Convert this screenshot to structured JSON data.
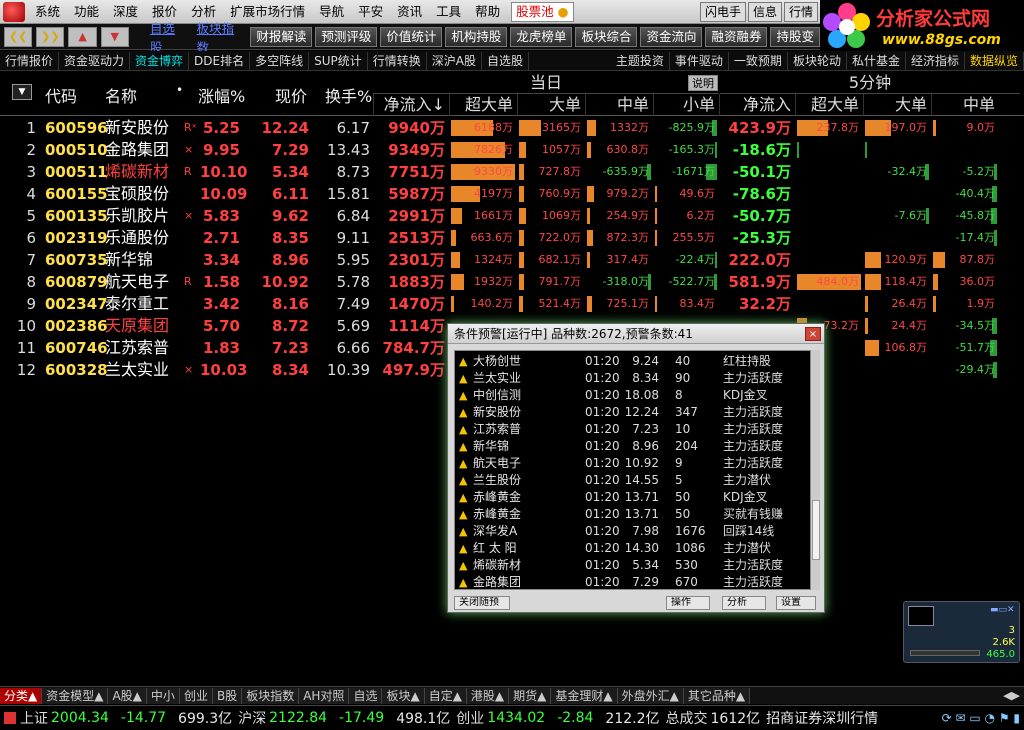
{
  "menubar": {
    "items": [
      "系统",
      "功能",
      "深度",
      "报价",
      "分析",
      "扩展市场行情",
      "导航",
      "平安",
      "资讯",
      "工具",
      "帮助"
    ],
    "stock_pool": "股票池",
    "right_buttons": [
      "闪电手",
      "信息",
      "行情"
    ]
  },
  "brand": {
    "title": "分析家公式网",
    "url": "www.88gs.com"
  },
  "toolbar": {
    "links": [
      "自选股",
      "板块指数"
    ],
    "buttons": [
      "财报解读",
      "预测评级",
      "价值统计",
      "机构持股",
      "龙虎榜单",
      "板块综合",
      "资金流向",
      "融资融券",
      "持股变"
    ]
  },
  "tabs2": {
    "left": [
      "行情报价",
      "资金驱动力",
      "资金博弈",
      "DDE排名",
      "多空阵线",
      "SUP统计",
      "行情转换",
      "深沪A股",
      "自选股"
    ],
    "right": [
      "主题投资",
      "事件驱动",
      "一致预期",
      "板块轮动",
      "私什基金",
      "经济指标",
      "数据纵览"
    ]
  },
  "header": {
    "code": "代码",
    "name": "名称",
    "dot": "•",
    "change": "涨幅%",
    "price": "现价",
    "turnover": "换手%",
    "group_today": "当日",
    "explain": "说明",
    "group_5min": "5分钟",
    "today_cols": [
      "净流入↓",
      "超大单",
      "大单",
      "中单",
      "小单"
    ],
    "min5_cols": [
      "净流入",
      "超大单",
      "大单",
      "中单"
    ]
  },
  "rows": [
    {
      "idx": "1",
      "code": "600596",
      "name": "新安股份",
      "red": false,
      "flag": "Rˣ",
      "chg": "5.25",
      "price": "12.24",
      "turn": "6.17",
      "net": "9940万",
      "today": [
        {
          "v": 6188,
          "t": "6188万"
        },
        {
          "v": 3165,
          "t": "3165万"
        },
        {
          "v": 1332,
          "t": "1332万"
        },
        {
          "v": -825.9,
          "t": "-825.9万"
        }
      ],
      "m5net": "423.9万",
      "m5": [
        {
          "v": 237.8,
          "t": "237.8万"
        },
        {
          "v": 197.0,
          "t": "197.0万"
        },
        {
          "v": 9.0,
          "t": "9.0万"
        }
      ]
    },
    {
      "idx": "2",
      "code": "000510",
      "name": "金路集团",
      "red": false,
      "flag": "×",
      "chg": "9.95",
      "price": "7.29",
      "turn": "13.43",
      "net": "9349万",
      "today": [
        {
          "v": 7826,
          "t": "7826万"
        },
        {
          "v": 1057,
          "t": "1057万"
        },
        {
          "v": 630.8,
          "t": "630.8万"
        },
        {
          "v": -165.3,
          "t": "-165.3万"
        }
      ],
      "m5net": "-18.6万",
      "m5": [
        {
          "v": -1,
          "t": ""
        },
        {
          "v": -1,
          "t": ""
        },
        {
          "v": 0,
          "t": ""
        }
      ]
    },
    {
      "idx": "3",
      "code": "000511",
      "name": "烯碳新材",
      "red": true,
      "flag": "R",
      "chg": "10.10",
      "price": "5.34",
      "turn": "8.73",
      "net": "7751万",
      "today": [
        {
          "v": 9330,
          "t": "9330万"
        },
        {
          "v": 727.8,
          "t": "727.8万"
        },
        {
          "v": -635.9,
          "t": "-635.9万"
        },
        {
          "v": -1671,
          "t": "-1671万"
        }
      ],
      "m5net": "-50.1万",
      "m5": [
        {
          "v": 0,
          "t": ""
        },
        {
          "v": -32.4,
          "t": "-32.4万"
        },
        {
          "v": -5.2,
          "t": "-5.2万"
        }
      ]
    },
    {
      "idx": "4",
      "code": "600155",
      "name": "宝硕股份",
      "red": false,
      "flag": "",
      "chg": "10.09",
      "price": "6.11",
      "turn": "15.81",
      "net": "5987万",
      "today": [
        {
          "v": 4197,
          "t": "4197万"
        },
        {
          "v": 760.9,
          "t": "760.9万"
        },
        {
          "v": 979.2,
          "t": "979.2万"
        },
        {
          "v": 49.6,
          "t": "49.6万"
        }
      ],
      "m5net": "-78.6万",
      "m5": [
        {
          "v": 0,
          "t": ""
        },
        {
          "v": 0,
          "t": ""
        },
        {
          "v": -40.4,
          "t": "-40.4万"
        }
      ]
    },
    {
      "idx": "5",
      "code": "600135",
      "name": "乐凯胶片",
      "red": false,
      "flag": "×",
      "chg": "5.83",
      "price": "9.62",
      "turn": "6.84",
      "net": "2991万",
      "today": [
        {
          "v": 1661,
          "t": "1661万"
        },
        {
          "v": 1069,
          "t": "1069万"
        },
        {
          "v": 254.9,
          "t": "254.9万"
        },
        {
          "v": 6.2,
          "t": "6.2万"
        }
      ],
      "m5net": "-50.7万",
      "m5": [
        {
          "v": 0,
          "t": ""
        },
        {
          "v": -7.6,
          "t": "-7.6万"
        },
        {
          "v": -45.8,
          "t": "-45.8万"
        }
      ]
    },
    {
      "idx": "6",
      "code": "002319",
      "name": "乐通股份",
      "red": false,
      "flag": "",
      "chg": "2.71",
      "price": "8.35",
      "turn": "9.11",
      "net": "2513万",
      "today": [
        {
          "v": 663.6,
          "t": "663.6万"
        },
        {
          "v": 722.0,
          "t": "722.0万"
        },
        {
          "v": 872.3,
          "t": "872.3万"
        },
        {
          "v": 255.5,
          "t": "255.5万"
        }
      ],
      "m5net": "-25.3万",
      "m5": [
        {
          "v": 0,
          "t": ""
        },
        {
          "v": 0,
          "t": ""
        },
        {
          "v": -17.4,
          "t": "-17.4万"
        }
      ]
    },
    {
      "idx": "7",
      "code": "600735",
      "name": "新华锦",
      "red": false,
      "flag": "",
      "chg": "3.34",
      "price": "8.96",
      "turn": "5.95",
      "net": "2301万",
      "today": [
        {
          "v": 1324,
          "t": "1324万"
        },
        {
          "v": 682.1,
          "t": "682.1万"
        },
        {
          "v": 317.4,
          "t": "317.4万"
        },
        {
          "v": -22.4,
          "t": "-22.4万"
        }
      ],
      "m5net": "222.0万",
      "m5": [
        {
          "v": 0,
          "t": ""
        },
        {
          "v": 120.9,
          "t": "120.9万"
        },
        {
          "v": 87.8,
          "t": "87.8万"
        }
      ]
    },
    {
      "idx": "8",
      "code": "600879",
      "name": "航天电子",
      "red": false,
      "flag": "R",
      "chg": "1.58",
      "price": "10.92",
      "turn": "5.78",
      "net": "1883万",
      "today": [
        {
          "v": 1932,
          "t": "1932万"
        },
        {
          "v": 791.7,
          "t": "791.7万"
        },
        {
          "v": -318.0,
          "t": "-318.0万"
        },
        {
          "v": -522.7,
          "t": "-522.7万"
        }
      ],
      "m5net": "581.9万",
      "m5": [
        {
          "v": 484.0,
          "t": "484.0万"
        },
        {
          "v": 118.4,
          "t": "118.4万"
        },
        {
          "v": 36.0,
          "t": "36.0万"
        }
      ]
    },
    {
      "idx": "9",
      "code": "002347",
      "name": "泰尔重工",
      "red": false,
      "flag": "",
      "chg": "3.42",
      "price": "8.16",
      "turn": "7.49",
      "net": "1470万",
      "today": [
        {
          "v": 140.2,
          "t": "140.2万"
        },
        {
          "v": 521.4,
          "t": "521.4万"
        },
        {
          "v": 725.1,
          "t": "725.1万"
        },
        {
          "v": 83.4,
          "t": "83.4万"
        }
      ],
      "m5net": "32.2万",
      "m5": [
        {
          "v": 0,
          "t": ""
        },
        {
          "v": 26.4,
          "t": "26.4万"
        },
        {
          "v": 1.9,
          "t": "1.9万"
        }
      ]
    },
    {
      "idx": "10",
      "code": "002386",
      "name": "天原集团",
      "red": true,
      "flag": "",
      "chg": "5.70",
      "price": "8.72",
      "turn": "5.69",
      "net": "1114万",
      "today": [
        {
          "v": 0,
          "t": ""
        },
        {
          "v": 0,
          "t": ""
        },
        {
          "v": 0,
          "t": ""
        },
        {
          "v": 0,
          "t": ""
        }
      ],
      "m5net": "",
      "m5": [
        {
          "v": 73.2,
          "t": "73.2万"
        },
        {
          "v": 24.4,
          "t": "24.4万"
        },
        {
          "v": -34.5,
          "t": "-34.5万"
        }
      ]
    },
    {
      "idx": "11",
      "code": "600746",
      "name": "江苏索普",
      "red": false,
      "flag": "",
      "chg": "1.83",
      "price": "7.23",
      "turn": "6.66",
      "net": "784.7万",
      "today": [
        {
          "v": 0,
          "t": ""
        },
        {
          "v": 0,
          "t": ""
        },
        {
          "v": 0,
          "t": ""
        },
        {
          "v": 0,
          "t": ""
        }
      ],
      "m5net": "",
      "m5": [
        {
          "v": 0,
          "t": ""
        },
        {
          "v": 106.8,
          "t": "106.8万"
        },
        {
          "v": -51.7,
          "t": "-51.7万"
        }
      ]
    },
    {
      "idx": "12",
      "code": "600328",
      "name": "兰太实业",
      "red": false,
      "flag": "×",
      "chg": "10.03",
      "price": "8.34",
      "turn": "10.39",
      "net": "497.9万",
      "today": [
        {
          "v": 0,
          "t": ""
        },
        {
          "v": 0,
          "t": ""
        },
        {
          "v": 0,
          "t": ""
        },
        {
          "v": 0,
          "t": ""
        }
      ],
      "m5net": "",
      "m5": [
        {
          "v": 0,
          "t": ""
        },
        {
          "v": 0,
          "t": ""
        },
        {
          "v": -29.4,
          "t": "-29.4万"
        }
      ]
    }
  ],
  "dialog": {
    "title": "条件预警[运行中] 品种数:2672,预警条数:41",
    "close": "×",
    "items": [
      {
        "name": "大杨创世",
        "time": "01:20",
        "price": "9.24",
        "count": "40",
        "event": "红柱持股"
      },
      {
        "name": "兰太实业",
        "time": "01:20",
        "price": "8.34",
        "count": "90",
        "event": "主力活跃度"
      },
      {
        "name": "中创信测",
        "time": "01:20",
        "price": "18.08",
        "count": "8",
        "event": "KDJ金叉"
      },
      {
        "name": "新安股份",
        "time": "01:20",
        "price": "12.24",
        "count": "347",
        "event": "主力活跃度"
      },
      {
        "name": "江苏索普",
        "time": "01:20",
        "price": "7.23",
        "count": "10",
        "event": "主力活跃度"
      },
      {
        "name": "新华锦",
        "time": "01:20",
        "price": "8.96",
        "count": "204",
        "event": "主力活跃度"
      },
      {
        "name": "航天电子",
        "time": "01:20",
        "price": "10.92",
        "count": "9",
        "event": "主力活跃度"
      },
      {
        "name": "兰生股份",
        "time": "01:20",
        "price": "14.55",
        "count": "5",
        "event": "主力潜伏"
      },
      {
        "name": "赤峰黄金",
        "time": "01:20",
        "price": "13.71",
        "count": "50",
        "event": "KDJ金叉"
      },
      {
        "name": "赤峰黄金",
        "time": "01:20",
        "price": "13.71",
        "count": "50",
        "event": "买就有钱赚"
      },
      {
        "name": "深华发A",
        "time": "01:20",
        "price": "7.98",
        "count": "1676",
        "event": "回踩14线"
      },
      {
        "name": "红 太 阳",
        "time": "01:20",
        "price": "14.30",
        "count": "1086",
        "event": "主力潜伏"
      },
      {
        "name": "烯碳新材",
        "time": "01:20",
        "price": "5.34",
        "count": "530",
        "event": "主力活跃度"
      },
      {
        "name": "金路集团",
        "time": "01:20",
        "price": "7.29",
        "count": "670",
        "event": "主力活跃度"
      }
    ],
    "buttons": [
      "关闭随预",
      "操作",
      "分析",
      "设置"
    ]
  },
  "mini": {
    "val1": "3",
    "val2": "2.6K",
    "val3": "465.0"
  },
  "bottomtabs": [
    "分类▲",
    "资金模型▲",
    "A股▲",
    "中小",
    "创业",
    "B股",
    "板块指数",
    "AH对照",
    "自选",
    "板块▲",
    "自定▲",
    "港股▲",
    "期货▲",
    "基金理财▲",
    "外盘外汇▲",
    "其它品种▲"
  ],
  "status": {
    "sh_label": "上证",
    "sh_val": "2004.34",
    "sh_chg": "-14.77",
    "sh_amt": "699.3亿",
    "hs_label": "沪深",
    "hs_val": "2122.84",
    "hs_chg": "-17.49",
    "hs_amt": "498.1亿",
    "cy_label": "创业",
    "cy_val": "1434.02",
    "cy_chg": "-2.84",
    "cy_amt": "212.2亿",
    "total_label": "总成交",
    "total_val": "1612亿",
    "broker": "招商证券深圳行情"
  },
  "colors": {
    "up": "#ff4040",
    "down": "#3dff3d",
    "bar_up": "#e8862a",
    "bar_down": "#2f9a3a"
  }
}
